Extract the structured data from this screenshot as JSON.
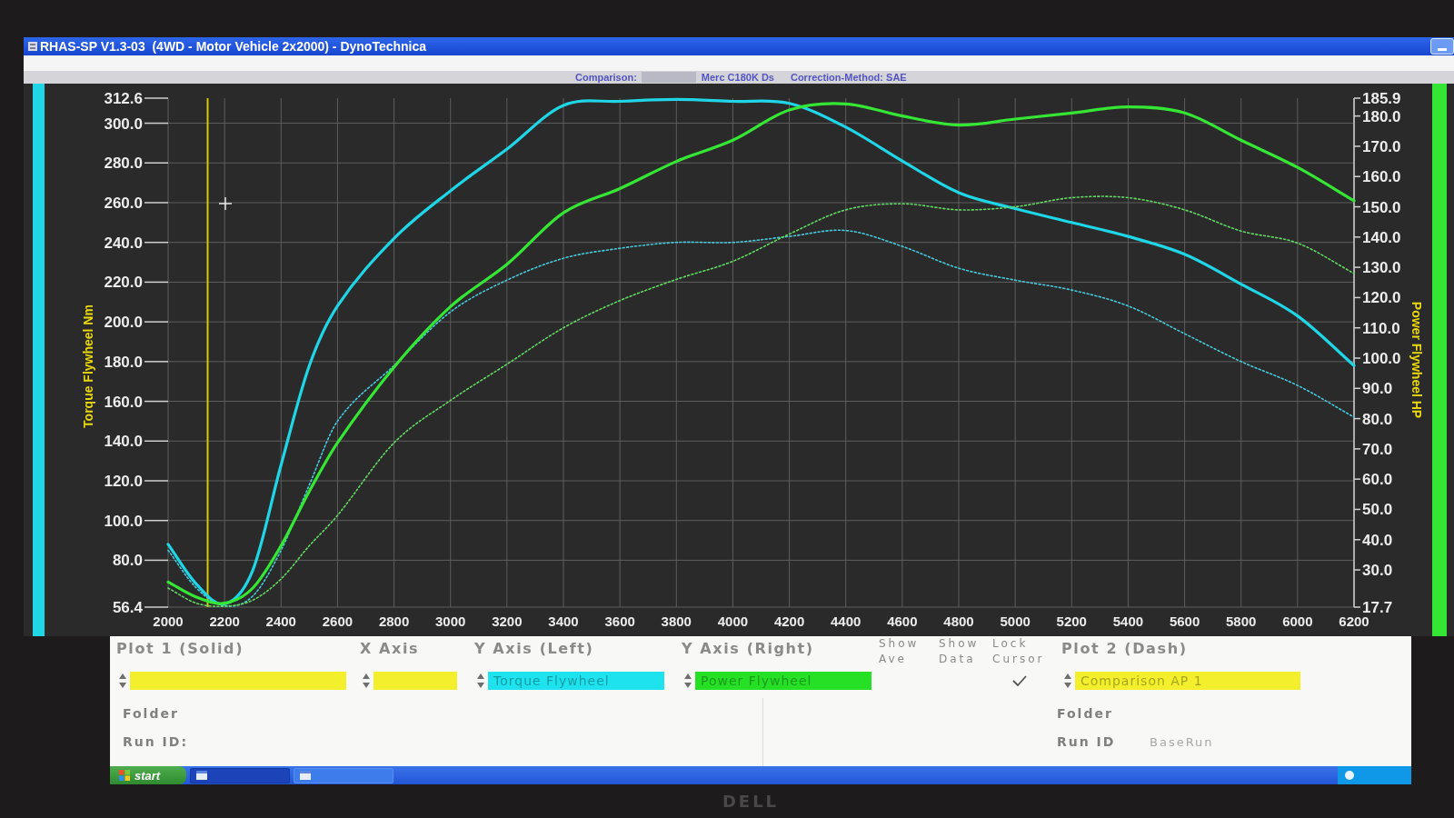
{
  "window": {
    "title": "RHAS-SP V1.3-03  (4WD - Motor Vehicle 2x2000) - DynoTechnica"
  },
  "info_bar": {
    "comparison_label": "Comparison:",
    "comparison_name": "Merc C180K Ds",
    "correction": "Correction-Method: SAE"
  },
  "chart_data": {
    "type": "line",
    "ylabel": "Torque Flywheel Nm",
    "y2label": "Power Flywheel HP",
    "grid": true,
    "x": [
      2000,
      2100,
      2200,
      2300,
      2400,
      2500,
      2600,
      2800,
      3000,
      3200,
      3400,
      3600,
      3800,
      4000,
      4200,
      4400,
      4600,
      4800,
      5000,
      5200,
      5400,
      5600,
      5800,
      6000,
      6200
    ],
    "xlim": [
      2000,
      6200
    ],
    "ylim": [
      56.4,
      312.6
    ],
    "y2lim": [
      17.7,
      185.9
    ],
    "xticks": [
      2000,
      2200,
      2400,
      2600,
      2800,
      3000,
      3200,
      3400,
      3600,
      3800,
      4000,
      4200,
      4400,
      4600,
      4800,
      5000,
      5200,
      5400,
      5600,
      5800,
      6000,
      6200
    ],
    "yticks": [
      {
        "value": 56.4,
        "label": "56.4"
      },
      {
        "value": 80,
        "label": "80.0"
      },
      {
        "value": 100,
        "label": "100.0"
      },
      {
        "value": 120,
        "label": "120.0"
      },
      {
        "value": 140,
        "label": "140.0"
      },
      {
        "value": 160,
        "label": "160.0"
      },
      {
        "value": 180,
        "label": "180.0"
      },
      {
        "value": 200,
        "label": "200.0"
      },
      {
        "value": 220,
        "label": "220.0"
      },
      {
        "value": 240,
        "label": "240.0"
      },
      {
        "value": 260,
        "label": "260.0"
      },
      {
        "value": 280,
        "label": "280.0"
      },
      {
        "value": 300,
        "label": "300.0"
      },
      {
        "value": 312.6,
        "label": "312.6"
      }
    ],
    "y2ticks": [
      {
        "value": 17.7,
        "label": "17.7"
      },
      {
        "value": 30,
        "label": "30.0"
      },
      {
        "value": 40,
        "label": "40.0"
      },
      {
        "value": 50,
        "label": "50.0"
      },
      {
        "value": 60,
        "label": "60.0"
      },
      {
        "value": 70,
        "label": "70.0"
      },
      {
        "value": 80,
        "label": "80.0"
      },
      {
        "value": 90,
        "label": "90.0"
      },
      {
        "value": 100,
        "label": "100.0"
      },
      {
        "value": 110,
        "label": "110.0"
      },
      {
        "value": 120,
        "label": "120.0"
      },
      {
        "value": 130,
        "label": "130.0"
      },
      {
        "value": 140,
        "label": "140.0"
      },
      {
        "value": 150,
        "label": "150.0"
      },
      {
        "value": 160,
        "label": "160.0"
      },
      {
        "value": 170,
        "label": "170.0"
      },
      {
        "value": 180,
        "label": "180.0"
      },
      {
        "value": 185.9,
        "label": "185.9"
      }
    ],
    "series": [
      {
        "color": "#1fd5e6",
        "line_style": "solid",
        "values": [
          88,
          68,
          58,
          75,
          128,
          178,
          208,
          242,
          266,
          287,
          309,
          311,
          312,
          311,
          310,
          298,
          281,
          265,
          257,
          250,
          243,
          234,
          219,
          203,
          178
        ]
      },
      {
        "color": "#46c8dc",
        "line_style": "dashed",
        "values": [
          85,
          66,
          57,
          62,
          85,
          118,
          150,
          178,
          205,
          221,
          232,
          237,
          240,
          240,
          243,
          246,
          238,
          227,
          221,
          216,
          208,
          194,
          180,
          168,
          152
        ]
      },
      {
        "color": "#35e635",
        "line_style": "solid",
        "axis": "y2",
        "values": [
          26,
          21,
          19,
          24,
          38,
          56,
          72,
          97,
          117,
          131,
          148,
          156,
          165,
          172,
          182,
          184,
          180,
          177,
          179,
          181,
          183,
          181,
          172,
          163,
          152
        ]
      },
      {
        "color": "#62d662",
        "line_style": "dashed",
        "axis": "y2",
        "values": [
          24,
          19,
          18,
          20,
          27,
          38,
          48,
          72,
          86,
          98,
          110,
          119,
          126,
          132,
          141,
          149,
          151,
          149,
          150,
          153,
          153,
          149,
          142,
          138,
          128
        ]
      }
    ],
    "ref_lines": [
      {
        "axis": "x",
        "value": 2140,
        "color": "#d6c700"
      }
    ]
  },
  "plot_panel": {
    "columns": [
      {
        "kind": "selector",
        "heading": "Plot 1 (Solid)",
        "color": "#f3ef2c"
      },
      {
        "kind": "selector",
        "heading": "X Axis",
        "color": "#f3ef2c"
      },
      {
        "kind": "selector",
        "heading": "Y Axis (Left)",
        "value": "Torque Flywheel",
        "color": "#1ee3ee"
      },
      {
        "kind": "selector",
        "heading": "Y Axis (Right)",
        "value": "Power Flywheel",
        "color": "#26e026"
      },
      {
        "kind": "checkbox",
        "heading": "Show Ave",
        "checked": false
      },
      {
        "kind": "checkbox",
        "heading": "Show Data",
        "checked": false
      },
      {
        "kind": "checkbox",
        "heading": "Lock Cursor",
        "checked": true
      },
      {
        "kind": "selector",
        "heading": "Plot 2 (Dash)",
        "value": "Comparison AP 1",
        "color": "#f3ef2c"
      }
    ]
  },
  "plot1_details": [
    {
      "label": "Folder"
    },
    {
      "label": "Run ID:"
    }
  ],
  "plot2_details": [
    {
      "label": "Folder"
    },
    {
      "label": "Run ID",
      "value": "BaseRun"
    }
  ],
  "taskbar": {
    "start": "start",
    "tasks": [
      {
        "selected": true
      },
      {
        "selected": false
      }
    ]
  },
  "monitor": {
    "logo": "DELL"
  }
}
